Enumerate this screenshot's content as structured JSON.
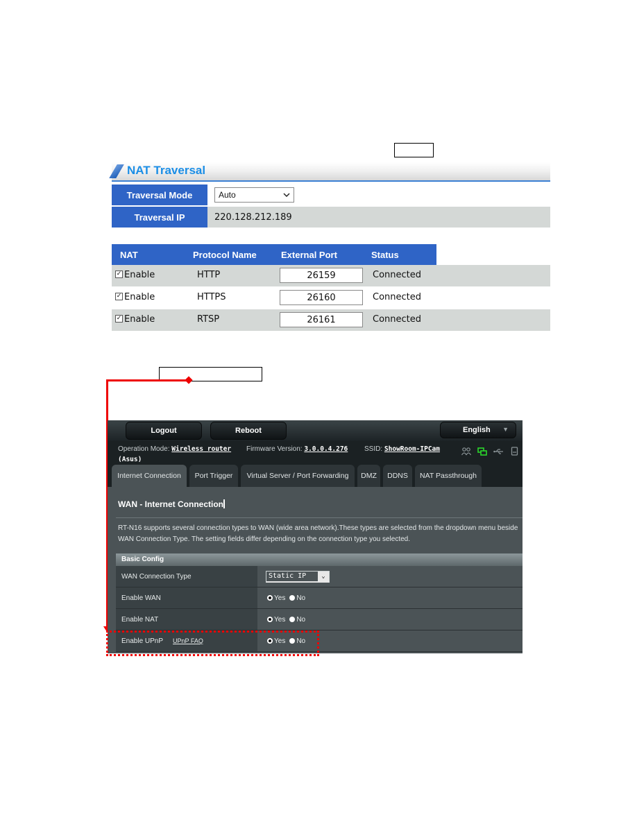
{
  "callouts": {
    "box1_text": "",
    "box2_text": ""
  },
  "nat_traversal": {
    "title": "NAT Traversal",
    "traversal_mode": {
      "label": "Traversal Mode",
      "value": "Auto",
      "chevron": "chevron-down"
    },
    "traversal_ip": {
      "label": "Traversal IP",
      "value": "220.128.212.189"
    },
    "table": {
      "headers": [
        "NAT",
        "Protocol Name",
        "External Port",
        "Status"
      ],
      "rows": [
        {
          "checked": true,
          "check_glyph": "✓",
          "nat": "Enable",
          "protocol": "HTTP",
          "port": "26159",
          "status": "Connected"
        },
        {
          "checked": true,
          "check_glyph": "✓",
          "nat": "Enable",
          "protocol": "HTTPS",
          "port": "26160",
          "status": "Connected"
        },
        {
          "checked": true,
          "check_glyph": "✓",
          "nat": "Enable",
          "protocol": "RTSP",
          "port": "26161",
          "status": "Connected"
        }
      ]
    }
  },
  "router": {
    "buttons": {
      "logout": "Logout",
      "reboot": "Reboot",
      "language": "English",
      "language_arrow": "▼"
    },
    "info": {
      "op_mode_label": "Operation Mode:",
      "op_mode_value": "Wireless router",
      "op_mode_suffix": "(Asus)",
      "firmware_label": "Firmware Version:",
      "firmware_value": "3.0.0.4.276",
      "ssid_label": "SSID:",
      "ssid_value": "ShowRoom-IPCam"
    },
    "status_icons": [
      "clients-icon",
      "network-icon",
      "usb-icon",
      "printer-icon"
    ],
    "status_colors": {
      "network_active": "#2bd62b",
      "inactive": "#8a9396"
    },
    "tabs": [
      {
        "label": "Internet Connection",
        "active": true
      },
      {
        "label": "Port Trigger",
        "active": false
      },
      {
        "label": "Virtual Server / Port Forwarding",
        "active": false
      },
      {
        "label": "DMZ",
        "active": false
      },
      {
        "label": "DDNS",
        "active": false
      },
      {
        "label": "NAT Passthrough",
        "active": false
      }
    ],
    "heading": "WAN - Internet Connection",
    "description": "RT-N16 supports several connection types to WAN (wide area network).These types are selected from the dropdown menu beside WAN Connection Type. The setting fields differ depending on the connection type you selected.",
    "section": "Basic Config",
    "rows": {
      "wan_type": {
        "label": "WAN Connection Type",
        "value": "Static IP",
        "arrow": "⌄"
      },
      "enable_wan": {
        "label": "Enable WAN",
        "yes": "Yes",
        "no": "No",
        "selected": "Yes"
      },
      "enable_nat": {
        "label": "Enable NAT",
        "yes": "Yes",
        "no": "No",
        "selected": "Yes"
      },
      "enable_upnp": {
        "label": "Enable UPnP",
        "link": "UPnP FAQ",
        "yes": "Yes",
        "no": "No",
        "selected": "Yes"
      }
    }
  },
  "colors": {
    "accent_blue": "#2f64c6",
    "title_blue": "#1b8ee6",
    "highlight_red": "#e00000"
  }
}
